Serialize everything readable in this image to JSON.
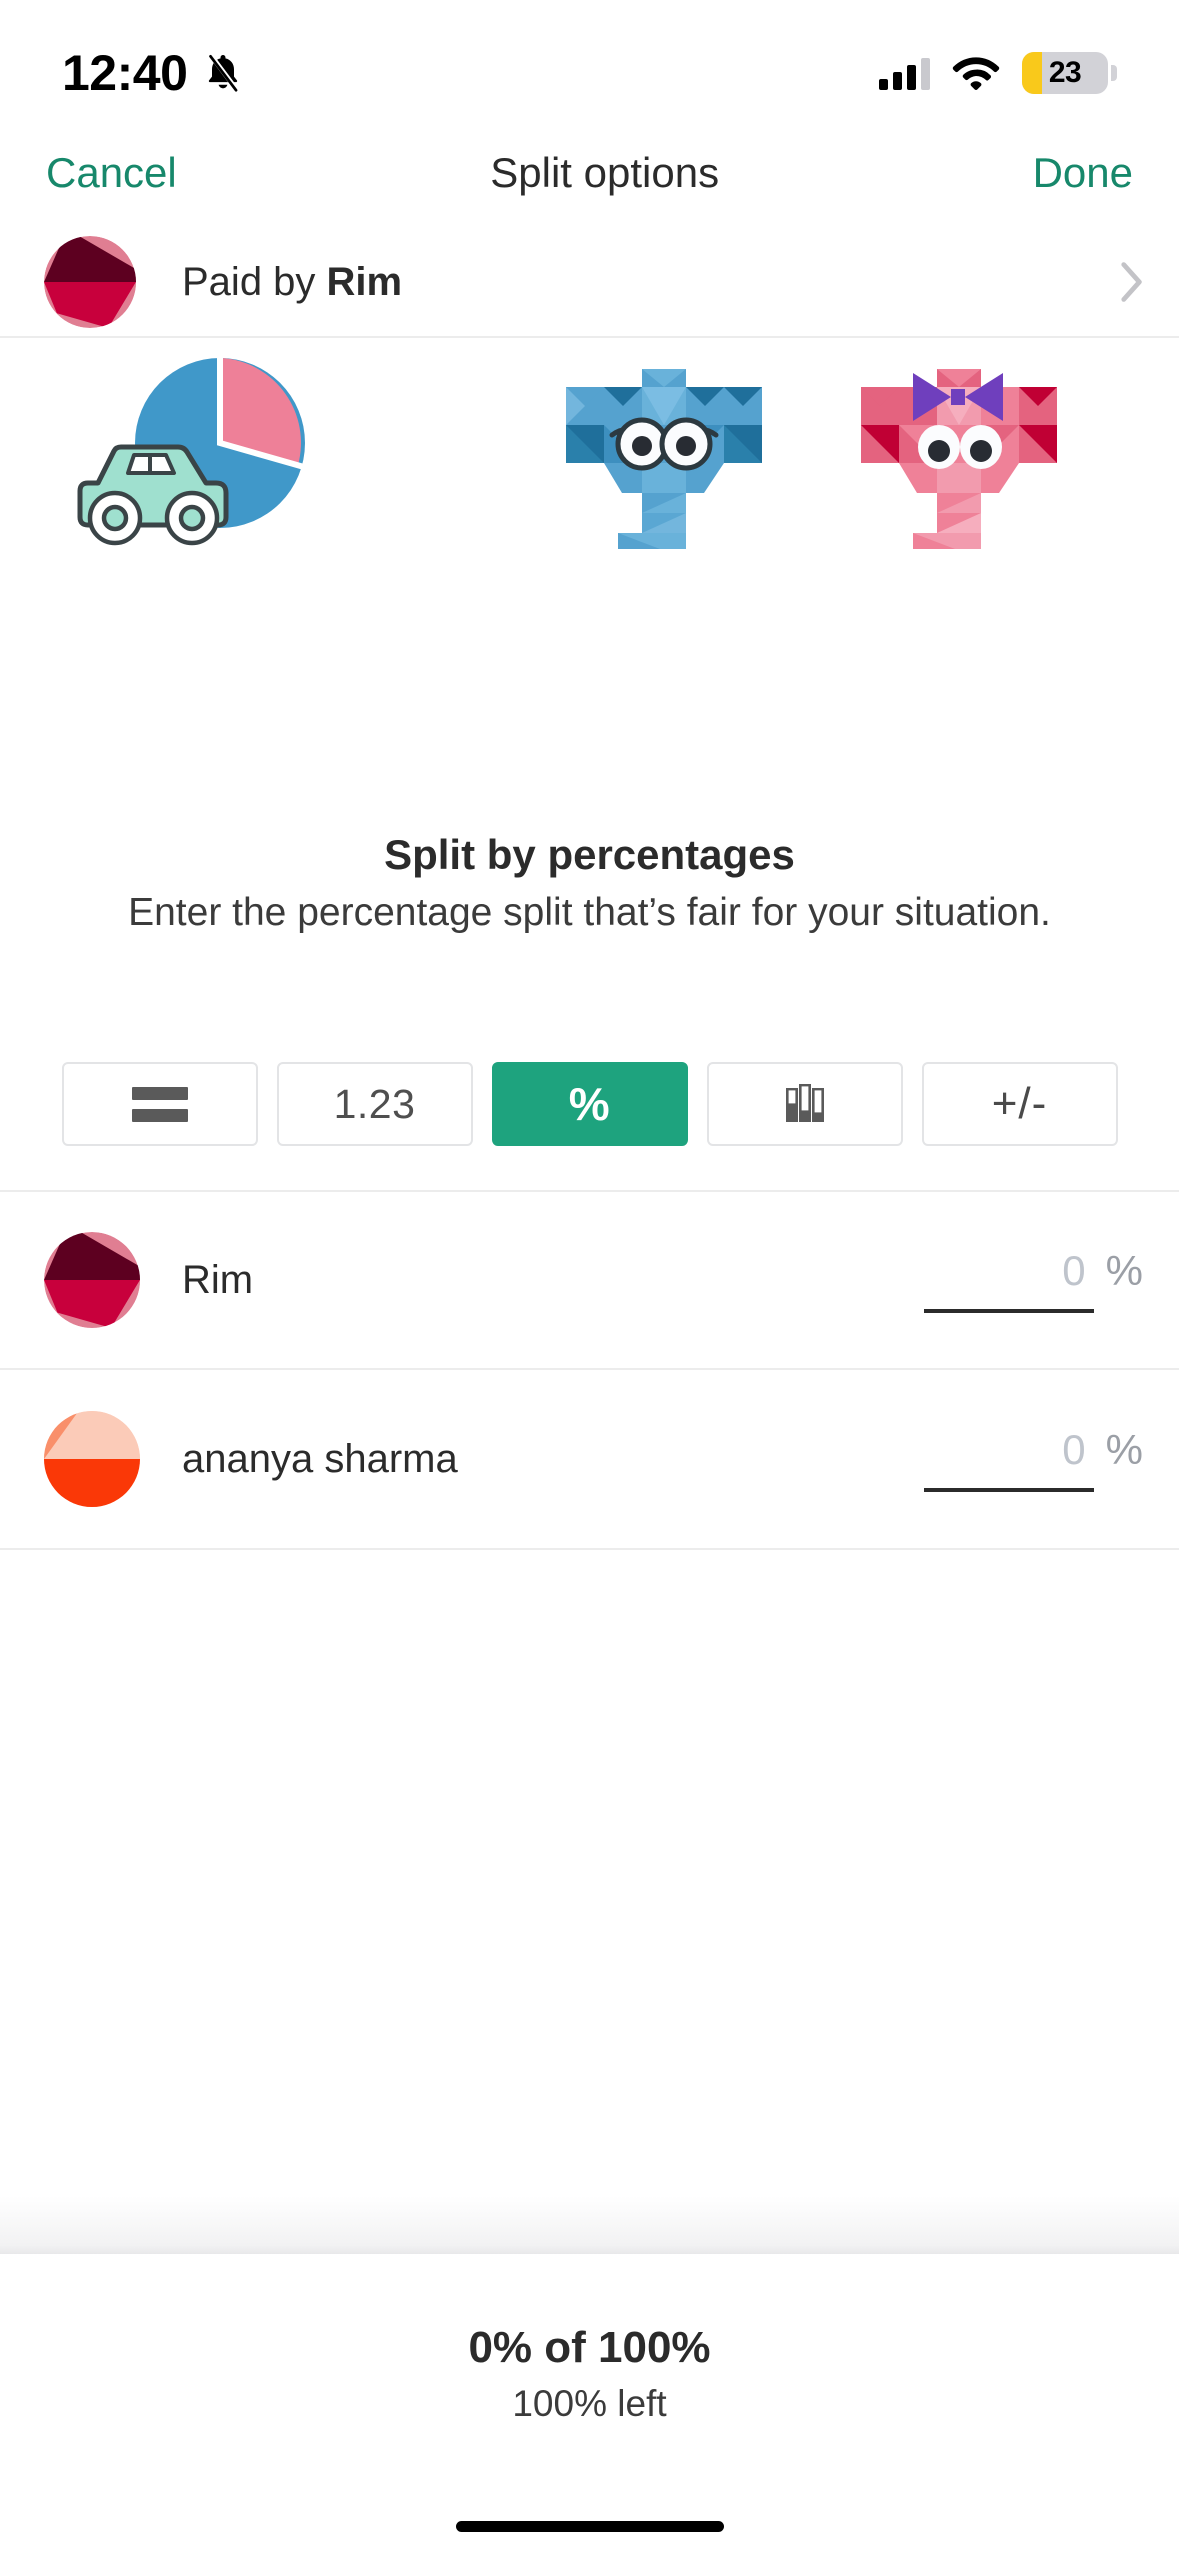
{
  "status_bar": {
    "time": "12:40",
    "silent_icon": "bell-slash-icon",
    "signal_icon": "cellular-signal-icon",
    "signal_bars_filled": 3,
    "signal_bars_total": 4,
    "wifi_icon": "wifi-icon",
    "battery_icon": "battery-icon",
    "battery_percent": "23",
    "battery_level": 23,
    "battery_fill_color": "#f9c91b"
  },
  "navbar": {
    "cancel_label": "Cancel",
    "title": "Split options",
    "done_label": "Done",
    "accent_color": "#17886b"
  },
  "paid_by": {
    "prefix": "Paid by ",
    "payer": "Rim",
    "avatar_name": "avatar-rim",
    "chevron_icon": "chevron-right-icon"
  },
  "illustration": {
    "car_icon": "car-icon",
    "pie_icon": "pie-chart-icon",
    "blue_elephant_icon": "elephant-blue-icon",
    "pink_elephant_icon": "elephant-pink-icon",
    "pie_slice_pink_pct": 25,
    "pie_slice_blue_pct": 75,
    "pie_blue": "#4098c9",
    "pie_pink": "#ee8098",
    "car_body": "#9fe0cf"
  },
  "headline": {
    "title": "Split by percentages",
    "subtitle": "Enter the percentage split that’s fair for your situation."
  },
  "split_modes": [
    {
      "id": "equally",
      "label": "=",
      "icon": "equals-icon",
      "active": false
    },
    {
      "id": "exact-amounts",
      "label": "1.23",
      "icon": "exact-amount-icon",
      "active": false
    },
    {
      "id": "percentages",
      "label": "%",
      "icon": "percent-icon",
      "active": true
    },
    {
      "id": "shares",
      "label": "",
      "icon": "shares-bars-icon",
      "active": false
    },
    {
      "id": "adjustment",
      "label": "+/-",
      "icon": "plus-minus-icon",
      "active": false
    }
  ],
  "active_mode_color": "#1ea37e",
  "participants": [
    {
      "name": "Rim",
      "avatar_name": "avatar-rim",
      "value": "",
      "placeholder": "0",
      "unit": "%"
    },
    {
      "name": "ananya sharma",
      "avatar_name": "avatar-ananya-sharma",
      "value": "",
      "placeholder": "0",
      "unit": "%"
    }
  ],
  "footer": {
    "summary": "0% of 100%",
    "remaining": "100% left"
  }
}
